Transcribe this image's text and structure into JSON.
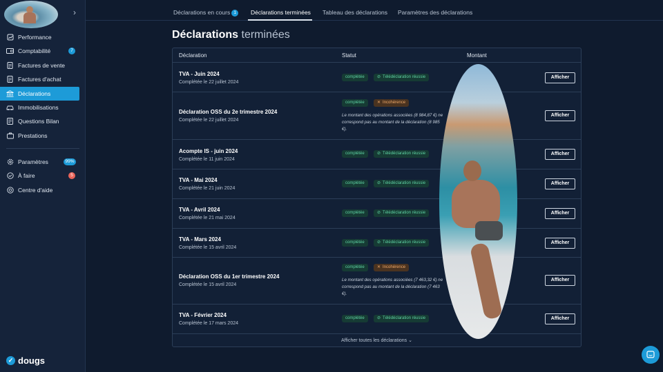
{
  "sidebar": {
    "items": [
      {
        "label": "Performance",
        "icon": "chart-icon",
        "badge": null
      },
      {
        "label": "Comptabilité",
        "icon": "wallet-icon",
        "badge": "7"
      },
      {
        "label": "Factures de vente",
        "icon": "document-icon",
        "badge": null
      },
      {
        "label": "Factures d'achat",
        "icon": "document-icon",
        "badge": null
      },
      {
        "label": "Déclarations",
        "icon": "bank-icon",
        "badge": null,
        "active": true
      },
      {
        "label": "Immobilisations",
        "icon": "car-icon",
        "badge": null
      },
      {
        "label": "Questions Bilan",
        "icon": "list-icon",
        "badge": null
      },
      {
        "label": "Prestations",
        "icon": "briefcase-icon",
        "badge": null
      }
    ],
    "secondary": [
      {
        "label": "Paramètres",
        "icon": "gear-icon",
        "badge": "99%"
      },
      {
        "label": "À faire",
        "icon": "check-circle-icon",
        "badge": "5"
      },
      {
        "label": "Centre d'aide",
        "icon": "help-icon",
        "badge": null
      }
    ],
    "logo": "dougs"
  },
  "tabs": [
    {
      "label": "Déclarations en cours",
      "count": "1"
    },
    {
      "label": "Déclarations terminées",
      "active": true
    },
    {
      "label": "Tableau des déclarations"
    },
    {
      "label": "Paramètres des déclarations"
    }
  ],
  "page": {
    "title_bold": "Déclarations",
    "title_light": "terminées"
  },
  "table": {
    "headers": {
      "declaration": "Déclaration",
      "statut": "Statut",
      "montant": "Montant"
    },
    "rows": [
      {
        "name": "TVA - Juin 2024",
        "date": "Complétée le 22 juillet 2024",
        "status": "complétée",
        "status2": "Télédéclaration réussie"
      },
      {
        "name": "Déclaration OSS du 2e trimestre 2024",
        "date": "Complétée le 22 juillet 2024",
        "status": "complétée",
        "status2": "Incohérence",
        "note": "Le montant des opérations associées (8 984,87 €) ne correspond pas au montant de la déclaration (8 985 €)."
      },
      {
        "name": "Acompte IS - juin 2024",
        "date": "Complétée le 11 juin 2024",
        "status": "complétée",
        "status2": "Télédéclaration réussie"
      },
      {
        "name": "TVA - Mai 2024",
        "date": "Complétée le 21 juin 2024",
        "status": "complétée",
        "status2": "Télédéclaration réussie"
      },
      {
        "name": "TVA - Avril 2024",
        "date": "Complétée le 21 mai 2024",
        "status": "complétée",
        "status2": "Télédéclaration réussie"
      },
      {
        "name": "TVA - Mars 2024",
        "date": "Complétée le 15 avril 2024",
        "status": "complétée",
        "status2": "Télédéclaration réussie"
      },
      {
        "name": "Déclaration OSS du 1er trimestre 2024",
        "date": "Complétée le 15 avril 2024",
        "status": "complétée",
        "status2": "Incohérence",
        "note": "Le montant des opérations associées (7 463,32 €) ne correspond pas au montant de la déclaration (7 463 €)."
      },
      {
        "name": "TVA - Février 2024",
        "date": "Complétée le 17 mars 2024",
        "status": "complétée",
        "status2": "Télédéclaration réussie"
      }
    ],
    "button_label": "Afficher",
    "show_all": "Afficher toutes les déclarations"
  },
  "colors": {
    "accent": "#1d9bd8",
    "background": "#0f1b2e",
    "sidebar": "#15233a",
    "success": "#5fd3a3",
    "warning": "#f0a968",
    "danger": "#e8645a"
  }
}
